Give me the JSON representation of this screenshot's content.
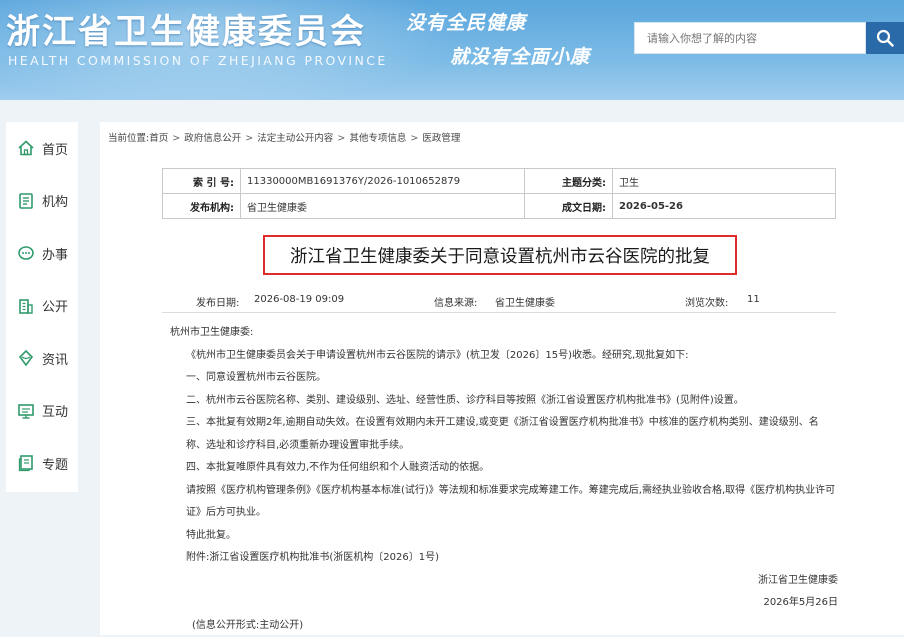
{
  "header": {
    "title": "浙江省卫生健康委员会",
    "subtitle": "HEALTH COMMISSION OF ZHEJIANG PROVINCE",
    "slogan_line1": "没有全民健康",
    "slogan_line2": "就没有全面小康",
    "search_placeholder": "请输入你想了解的内容",
    "search_icon": "search-icon"
  },
  "sidebar": {
    "items": [
      {
        "label": "首页",
        "icon": "home-icon"
      },
      {
        "label": "机构",
        "icon": "document-icon"
      },
      {
        "label": "办事",
        "icon": "chat-icon"
      },
      {
        "label": "公开",
        "icon": "building-icon"
      },
      {
        "label": "资讯",
        "icon": "globe-icon"
      },
      {
        "label": "互动",
        "icon": "monitor-icon"
      },
      {
        "label": "专题",
        "icon": "notes-icon"
      }
    ]
  },
  "breadcrumb": {
    "prefix": "当前位置:",
    "items": [
      "首页",
      "政府信息公开",
      "法定主动公开内容",
      "其他专项信息",
      "医政管理"
    ],
    "separator": ">"
  },
  "info": {
    "index_label": "索 引 号:",
    "index_value": "11330000MB1691376Y/2026-1010652879",
    "category_label": "主题分类:",
    "category_value": "卫生",
    "issuer_label": "发布机构:",
    "issuer_value": "省卫生健康委",
    "date_label": "成文日期:",
    "date_value": "2026-05-26"
  },
  "document": {
    "title": "浙江省卫生健康委关于同意设置杭州市云谷医院的批复",
    "publish_date_label": "发布日期:",
    "publish_date": "2026-08-19 09:09",
    "source_label": "信息来源:",
    "source": "省卫生健康委",
    "views_label": "浏览次数:",
    "views": "11",
    "salutation": "杭州市卫生健康委:",
    "p1": "《杭州市卫生健康委员会关于申请设置杭州市云谷医院的请示》(杭卫发〔2026〕15号)收悉。经研究,现批复如下:",
    "p2": "一、同意设置杭州市云谷医院。",
    "p3": "二、杭州市云谷医院名称、类别、建设级别、选址、经营性质、诊疗科目等按照《浙江省设置医疗机构批准书》(见附件)设置。",
    "p4": "三、本批复有效期2年,逾期自动失效。在设置有效期内未开工建设,或变更《浙江省设置医疗机构批准书》中核准的医疗机构类别、建设级别、名称、选址和诊疗科目,必须重新办理设置审批手续。",
    "p5": "四、本批复唯原件具有效力,不作为任何组织和个人融资活动的依据。",
    "p6": "请按照《医疗机构管理条例》《医疗机构基本标准(试行)》等法规和标准要求完成筹建工作。筹建完成后,需经执业验收合格,取得《医疗机构执业许可证》后方可执业。",
    "p7": "特此批复。",
    "attachment": "附件:浙江省设置医疗机构批准书(浙医机构〔2026〕1号)",
    "signature": "浙江省卫生健康委",
    "sign_date": "2026年5月26日",
    "disclosure": "(信息公开形式:主动公开)"
  },
  "colors": {
    "header_blue": "#5aa6dd",
    "search_button": "#2b6aa8",
    "title_border": "#e02b2b",
    "icon_green": "#2f9a6a"
  }
}
